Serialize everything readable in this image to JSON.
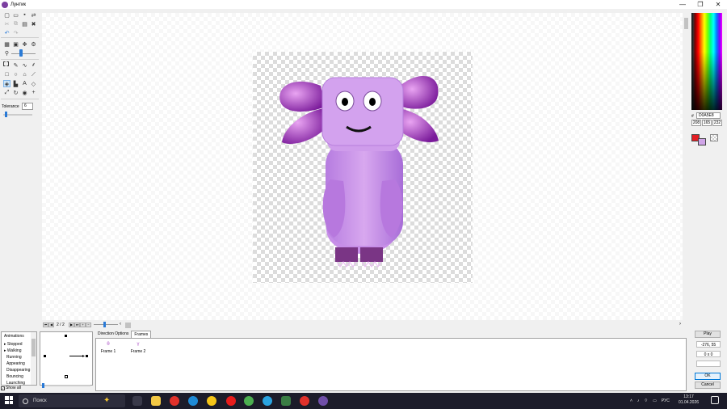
{
  "window": {
    "title": "Лунтик",
    "min": "—",
    "max": "❐",
    "close": "✕"
  },
  "toolbar": {
    "tolerance_label": "Tolerance",
    "tolerance_value": "6",
    "icons": [
      "new-file-icon",
      "open-icon",
      "save-icon",
      "export-icon",
      "cut-icon",
      "copy-icon",
      "paste-icon",
      "delete-icon",
      "undo-icon",
      "redo-icon",
      "grid-icon",
      "frame-icon",
      "move-icon",
      "settings-icon",
      "zoom-icon",
      "select-rect-icon",
      "pencil-icon",
      "brush-icon",
      "spray-icon",
      "rectangle-icon",
      "ellipse-icon",
      "polygon-icon",
      "line-icon",
      "fill-icon",
      "replace-icon",
      "text-icon",
      "eraser-icon",
      "line-tool-icon",
      "rotate-icon",
      "eye-icon",
      "plus-icon"
    ]
  },
  "color": {
    "hex_label": "#",
    "hex": "D0A5E8",
    "r": "208",
    "g": "165",
    "b": "232",
    "primary": "#e31e24",
    "secondary": "#d0a5e8"
  },
  "framebar": {
    "counter": "2 / 2"
  },
  "animations": {
    "header": "Animations",
    "items": [
      "▸ Stopped",
      "▸ Walking",
      "Running",
      "Appearing",
      "Disappearing",
      "Bouncing",
      "Launching"
    ],
    "show_all": "Show all"
  },
  "tabs": [
    "Direction Options",
    "Frames"
  ],
  "frames": [
    {
      "label": "Frame 1"
    },
    {
      "label": "Frame 2"
    }
  ],
  "right_panel": {
    "play": "Play",
    "coords": "-276, 55",
    "size": "0 x 0",
    "ok": "OK",
    "cancel": "Cancel"
  },
  "taskbar": {
    "search": "Поиск",
    "lang": "РУС",
    "time": "13:17",
    "date": "01.04.2026"
  }
}
